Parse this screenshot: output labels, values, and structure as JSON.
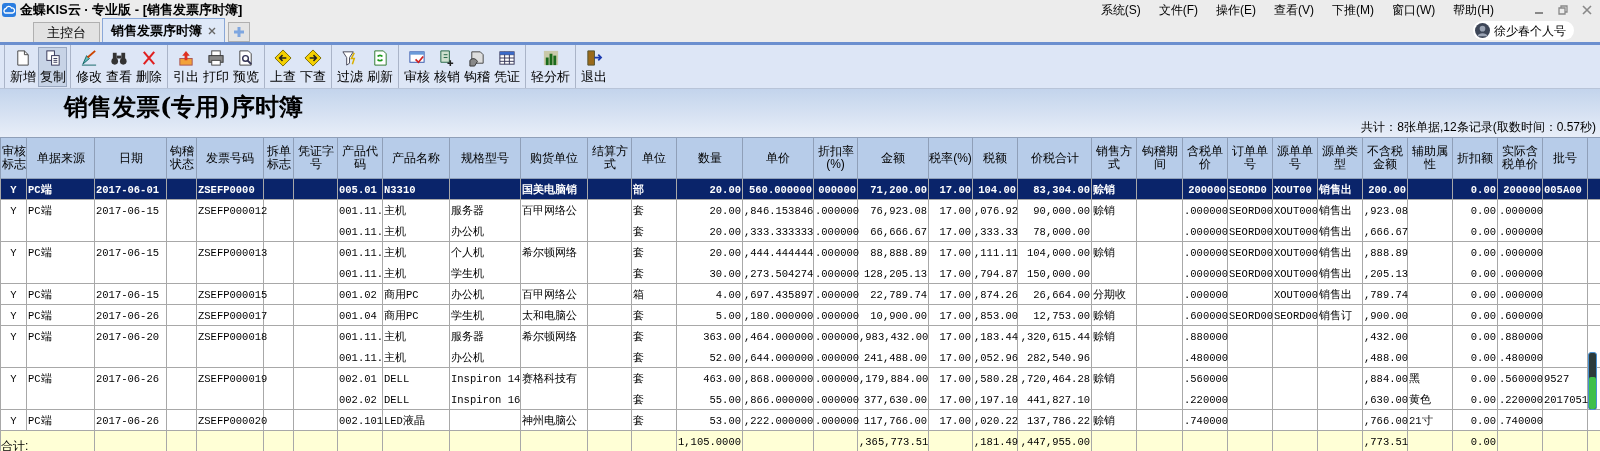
{
  "window": {
    "title": "金蝶KIS云 · 专业版 - [销售发票序时簿]"
  },
  "menu": [
    "系统(S)",
    "文件(F)",
    "操作(E)",
    "查看(V)",
    "下推(M)",
    "窗口(W)",
    "帮助(H)"
  ],
  "user": {
    "name": "徐少春个人号"
  },
  "tabs": [
    {
      "label": "主控台",
      "selected": false
    },
    {
      "label": "销售发票序时簿",
      "selected": true
    }
  ],
  "toolbar": [
    [
      {
        "label": "新增",
        "selected": false
      },
      {
        "label": "复制",
        "selected": true
      }
    ],
    [
      {
        "label": "修改",
        "selected": false
      },
      {
        "label": "查看",
        "selected": false
      },
      {
        "label": "删除",
        "selected": false
      }
    ],
    [
      {
        "label": "引出",
        "selected": false
      },
      {
        "label": "打印",
        "selected": false
      },
      {
        "label": "预览",
        "selected": false
      }
    ],
    [
      {
        "label": "上查",
        "selected": false
      },
      {
        "label": "下查",
        "selected": false
      }
    ],
    [
      {
        "label": "过滤",
        "selected": false
      },
      {
        "label": "刷新",
        "selected": false
      }
    ],
    [
      {
        "label": "审核",
        "selected": false
      },
      {
        "label": "核销",
        "selected": false
      },
      {
        "label": "钩稽",
        "selected": false
      },
      {
        "label": "凭证",
        "selected": false
      }
    ],
    [
      {
        "label": "轻分析",
        "selected": false
      }
    ],
    [
      {
        "label": "退出",
        "selected": false
      }
    ]
  ],
  "report": {
    "title": "销售发票(专用)序时簿",
    "summary": "共计：8张单据,12条记录(取数时间：0.57秒)"
  },
  "table": {
    "columns": [
      "审核标志",
      "单据来源",
      "日期",
      "钩稽状态",
      "发票号码",
      "拆单标志",
      "凭证字号",
      "产品代码",
      "产品名称",
      "规格型号",
      "购货单位",
      "结算方式",
      "单位",
      "数量",
      "单价",
      "折扣率(%)",
      "金额",
      "税率(%)",
      "税额",
      "价税合计",
      "销售方式",
      "钩稽期间",
      "含税单价",
      "订单单号",
      "源单单号",
      "源单类型",
      "不含税金额",
      "辅助属性",
      "折扣额",
      "实际含税单价",
      "批号"
    ],
    "rows": [
      {
        "selected": true,
        "audit": "Y",
        "source": "PC端",
        "date": "2017-06-01",
        "invoice_no": "ZSEFP0000",
        "buyer": "国美电脑销",
        "sales_method": "赊销",
        "lines": [
          {
            "product_code": "005.01",
            "product_name": "N3310",
            "unit": "部",
            "qty": "20.00",
            "price": "560.000000",
            "discount_rate": "000000",
            "amount": "71,200.00",
            "tax_rate": "17.00",
            "tax": "104.00",
            "total": "83,304.00",
            "tax_price": "200000",
            "order_no": "SEORD0",
            "source_no": "XOUT00",
            "source_type": "销售出",
            "net_amount": "200.00",
            "discount_amount": "0.00",
            "actual_price": "200000",
            "batch_no": "005A00"
          }
        ]
      },
      {
        "selected": false,
        "audit": "Y",
        "source": "PC端",
        "date": "2017-06-15",
        "invoice_no": "ZSEFP000012",
        "buyer": "百甲网络公",
        "sales_method": "赊销",
        "lines": [
          {
            "product_code": "001.11.",
            "product_name": "主机",
            "spec": "服务器",
            "unit": "套",
            "qty": "20.00",
            "price": ",846.153846",
            "discount_rate": ".000000",
            "amount": "76,923.08",
            "tax_rate": "17.00",
            "tax": ",076.92",
            "total": "90,000.00",
            "tax_price": ".000000",
            "order_no": "SEORD00",
            "source_no": "XOUT000",
            "source_type": "销售出",
            "net_amount": ",923.08",
            "discount_amount": "0.00",
            "actual_price": ".000000"
          },
          {
            "product_code": "001.11.",
            "product_name": "主机",
            "spec": "办公机",
            "unit": "套",
            "qty": "20.00",
            "price": ",333.333333",
            "discount_rate": ".000000",
            "amount": "66,666.67",
            "tax_rate": "17.00",
            "tax": ",333.33",
            "total": "78,000.00",
            "tax_price": ".000000",
            "order_no": "SEORD00",
            "source_no": "XOUT000",
            "source_type": "销售出",
            "net_amount": ",666.67",
            "discount_amount": "0.00",
            "actual_price": ".000000"
          }
        ]
      },
      {
        "selected": false,
        "audit": "Y",
        "source": "PC端",
        "date": "2017-06-15",
        "invoice_no": "ZSEFP000013",
        "buyer": "希尔顿网络",
        "sales_method": "赊销",
        "lines": [
          {
            "product_code": "001.11.",
            "product_name": "主机",
            "spec": "个人机",
            "unit": "套",
            "qty": "20.00",
            "price": ",444.444444",
            "discount_rate": ".000000",
            "amount": "88,888.89",
            "tax_rate": "17.00",
            "tax": ",111.11",
            "total": "104,000.00",
            "tax_price": ".000000",
            "order_no": "SEORD00",
            "source_no": "XOUT000",
            "source_type": "销售出",
            "net_amount": ",888.89",
            "discount_amount": "0.00",
            "actual_price": ".000000"
          },
          {
            "product_code": "001.11.",
            "product_name": "主机",
            "spec": "学生机",
            "unit": "套",
            "qty": "30.00",
            "price": ",273.504274",
            "discount_rate": ".000000",
            "amount": "128,205.13",
            "tax_rate": "17.00",
            "tax": ",794.87",
            "total": "150,000.00",
            "tax_price": ".000000",
            "order_no": "SEORD00",
            "source_no": "XOUT000",
            "source_type": "销售出",
            "net_amount": ",205.13",
            "discount_amount": "0.00",
            "actual_price": ".000000"
          }
        ]
      },
      {
        "selected": false,
        "audit": "Y",
        "source": "PC端",
        "date": "2017-06-15",
        "invoice_no": "ZSEFP000015",
        "buyer": "百甲网络公",
        "sales_method": "分期收",
        "lines": [
          {
            "product_code": "001.02",
            "product_name": "商用PC",
            "spec": "办公机",
            "unit": "箱",
            "qty": "4.00",
            "price": ",697.435897",
            "discount_rate": ".000000",
            "amount": "22,789.74",
            "tax_rate": "17.00",
            "tax": ",874.26",
            "total": "26,664.00",
            "tax_price": ".000000",
            "source_no": "XOUT000",
            "source_type": "销售出",
            "net_amount": ",789.74",
            "discount_amount": "0.00",
            "actual_price": ".000000"
          }
        ]
      },
      {
        "selected": false,
        "audit": "Y",
        "source": "PC端",
        "date": "2017-06-26",
        "invoice_no": "ZSEFP000017",
        "buyer": "太和电脑公",
        "sales_method": "赊销",
        "lines": [
          {
            "product_code": "001.04",
            "product_name": "商用PC",
            "spec": "学生机",
            "unit": "套",
            "qty": "5.00",
            "price": ",180.000000",
            "discount_rate": ".000000",
            "amount": "10,900.00",
            "tax_rate": "17.00",
            "tax": ",853.00",
            "total": "12,753.00",
            "tax_price": ".600000",
            "order_no": "SEORD00",
            "source_no": "SEORD00",
            "source_type": "销售订",
            "net_amount": ",900.00",
            "discount_amount": "0.00",
            "actual_price": ".600000"
          }
        ]
      },
      {
        "selected": false,
        "audit": "Y",
        "source": "PC端",
        "date": "2017-06-20",
        "invoice_no": "ZSEFP000018",
        "buyer": "希尔顿网络",
        "sales_method": "赊销",
        "lines": [
          {
            "product_code": "001.11.",
            "product_name": "主机",
            "spec": "服务器",
            "unit": "套",
            "qty": "363.00",
            "price": ",464.000000",
            "discount_rate": ".000000",
            "amount": ",983,432.00",
            "tax_rate": "17.00",
            "tax": ",183.44",
            "total": ",320,615.44",
            "tax_price": ".880000",
            "net_amount": ",432.00",
            "discount_amount": "0.00",
            "actual_price": ".880000"
          },
          {
            "product_code": "001.11.",
            "product_name": "主机",
            "spec": "办公机",
            "unit": "套",
            "qty": "52.00",
            "price": ",644.000000",
            "discount_rate": ".000000",
            "amount": "241,488.00",
            "tax_rate": "17.00",
            "tax": ",052.96",
            "total": "282,540.96",
            "tax_price": ".480000",
            "net_amount": ",488.00",
            "discount_amount": "0.00",
            "actual_price": ".480000"
          }
        ]
      },
      {
        "selected": false,
        "audit": "Y",
        "source": "PC端",
        "date": "2017-06-26",
        "invoice_no": "ZSEFP000019",
        "buyer": "赛格科技有",
        "sales_method": "赊销",
        "lines": [
          {
            "product_code": "002.01",
            "product_name": "DELL",
            "spec": "Inspiron 14",
            "unit": "套",
            "qty": "463.00",
            "price": ",868.000000",
            "discount_rate": ".000000",
            "amount": ",179,884.00",
            "tax_rate": "17.00",
            "tax": ",580.28",
            "total": ",720,464.28",
            "tax_price": ".560000",
            "net_amount": ",884.00",
            "aux": "黑",
            "discount_amount": "0.00",
            "actual_price": ".560000",
            "batch_no": "9527"
          },
          {
            "product_code": "002.02",
            "product_name": "DELL",
            "spec": "Inspiron 16",
            "unit": "套",
            "qty": "55.00",
            "price": ",866.000000",
            "discount_rate": ".000000",
            "amount": "377,630.00",
            "tax_rate": "17.00",
            "tax": ",197.10",
            "total": "441,827.10",
            "tax_price": ".220000",
            "net_amount": ",630.00",
            "aux": "黄色",
            "discount_amount": "0.00",
            "actual_price": ".220000",
            "batch_no": "2017051"
          }
        ]
      },
      {
        "selected": false,
        "audit": "Y",
        "source": "PC端",
        "date": "2017-06-26",
        "invoice_no": "ZSEFP000020",
        "buyer": "神州电脑公",
        "sales_method": "赊销",
        "lines": [
          {
            "product_code": "002.101",
            "product_name": "LED液晶",
            "unit": "套",
            "qty": "53.00",
            "price": ",222.000000",
            "discount_rate": ".000000",
            "amount": "117,766.00",
            "tax_rate": "17.00",
            "tax": ",020.22",
            "total": "137,786.22",
            "tax_price": ".740000",
            "net_amount": ",766.00",
            "aux": "21寸",
            "discount_amount": "0.00",
            "actual_price": ".740000"
          }
        ]
      }
    ],
    "totals": {
      "label": "合计:",
      "qty": "1,105.0000",
      "amount": ",365,773.51",
      "tax": ",181.49",
      "total": ",447,955.00",
      "net_amount": ",773.51",
      "discount_amount": "0.00"
    }
  }
}
